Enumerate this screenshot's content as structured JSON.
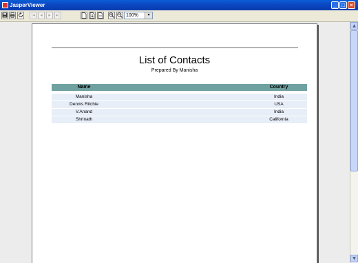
{
  "window": {
    "title": "JasperViewer",
    "min_label": "_",
    "max_label": "□",
    "close_label": "×"
  },
  "toolbar": {
    "save_icon": "floppy-disk",
    "print_icon": "printer",
    "reload_icon": "reload",
    "first_glyph": "|◂",
    "prev_glyph": "◂",
    "next_glyph": "▸",
    "last_glyph": "▸|",
    "page_value": "",
    "zoom_in_glyph": "+",
    "zoom_out_glyph": "−",
    "zoom_value": "100%",
    "zoom_drop_glyph": "▾"
  },
  "report": {
    "title": "List of Contacts",
    "subtitle": "Prepared By Manisha",
    "columns": {
      "name": "Name",
      "country": "Country"
    },
    "rows": [
      {
        "name": "Manisha",
        "country": "India"
      },
      {
        "name": "Dennis Ritchie",
        "country": "USA"
      },
      {
        "name": "V.Anand",
        "country": "India"
      },
      {
        "name": "Shrinath",
        "country": "California"
      }
    ],
    "header_color": "#6fa1a1",
    "row_color": "#e8eef8"
  },
  "scroll": {
    "up_glyph": "▲",
    "down_glyph": "▼"
  }
}
